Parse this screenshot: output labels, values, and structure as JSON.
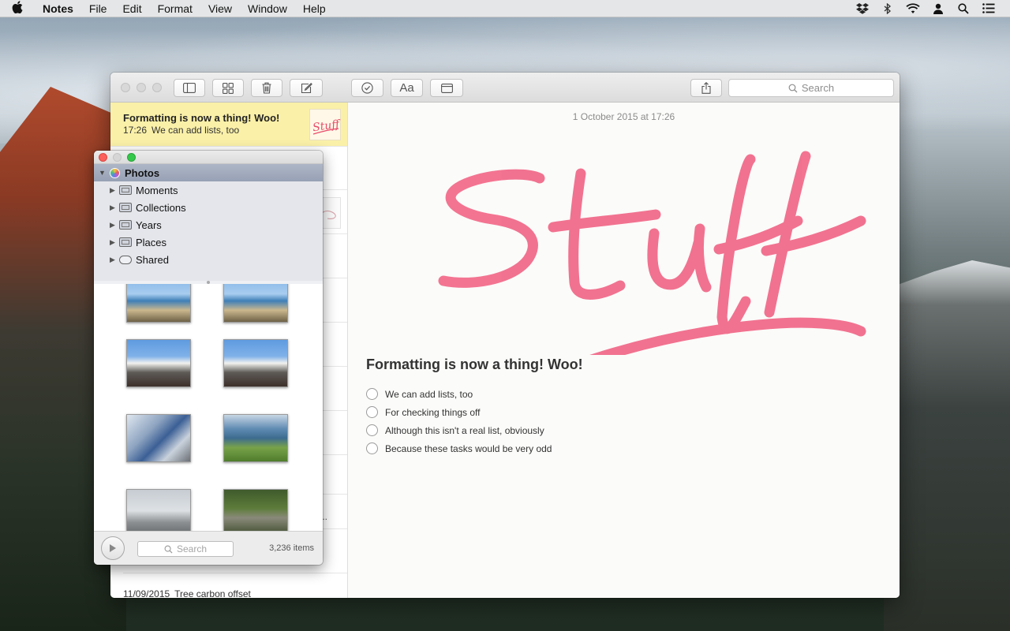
{
  "menubar": {
    "apple_icon": "apple-logo-icon",
    "app_name": "Notes",
    "items": [
      "File",
      "Edit",
      "Format",
      "View",
      "Window",
      "Help"
    ],
    "status_icons": [
      "dropbox-icon",
      "bluetooth-icon",
      "wifi-icon",
      "user-icon",
      "spotlight-search-icon",
      "notification-center-icon"
    ]
  },
  "toolbar": {
    "buttons": [
      "sidebar-toggle",
      "attachments-browser",
      "delete",
      "new-note",
      "checklist",
      "format",
      "table"
    ],
    "format_label": "Aa",
    "search_placeholder": "Search"
  },
  "note_list": {
    "selected": {
      "title": "Formatting is now a thing! Woo!",
      "time": "17:26",
      "preview": "We can add lists, too",
      "thumbnail_text": "Stuff"
    },
    "last": {
      "date": "11/09/2015",
      "preview": "Tree carbon offset"
    },
    "truncated_text": "..."
  },
  "editor": {
    "date": "1 October 2015 at 17:26",
    "sketch_text": "Stuff",
    "sketch_color": "#f0557a",
    "title": "Formatting is now a thing! Woo!",
    "checklist": [
      "We can add lists, too",
      "For checking things off",
      "Although this isn't a real list, obviously",
      "Because these tasks would be very odd"
    ]
  },
  "photos_panel": {
    "source_title": "Photos",
    "sources": [
      {
        "label": "Moments",
        "icon": "folder-icon"
      },
      {
        "label": "Collections",
        "icon": "folder-icon"
      },
      {
        "label": "Years",
        "icon": "folder-icon"
      },
      {
        "label": "Places",
        "icon": "folder-icon"
      },
      {
        "label": "Shared",
        "icon": "cloud-icon"
      }
    ],
    "search_placeholder": "Search",
    "count": "3,236 items",
    "traffic_colors": [
      "#fc605c",
      "#d3d3d3",
      "#34c84a"
    ]
  }
}
